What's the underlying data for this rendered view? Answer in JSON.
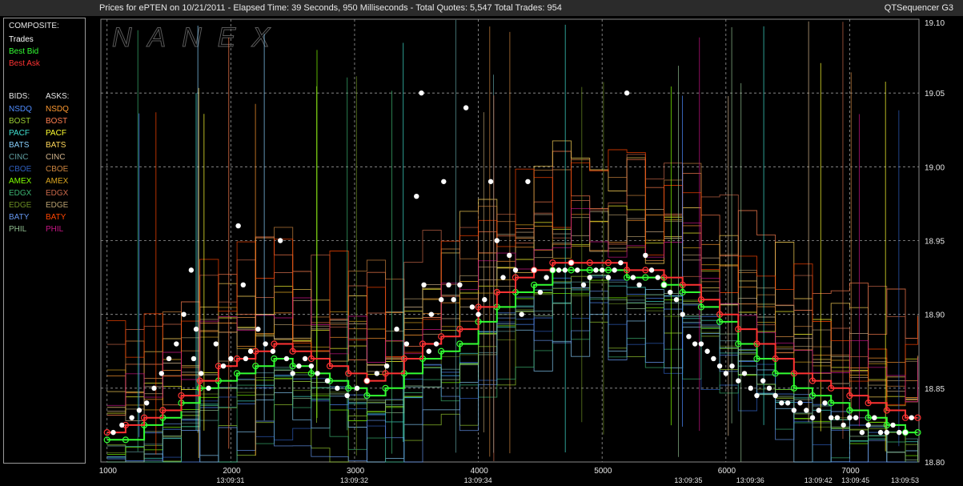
{
  "header": {
    "title": "Prices for  ePTEN  on  10/21/2011  - Elapsed Time: 39 Seconds, 950 Milliseconds  -  Total Quotes: 5,547  Total Trades: 954",
    "product": "QTSequencer G3"
  },
  "watermark": "NANEX",
  "legend": {
    "composite_heading": "COMPOSITE:",
    "composite": [
      {
        "label": "Trades",
        "color": "#ffffff"
      },
      {
        "label": "Best Bid",
        "color": "#33ff33"
      },
      {
        "label": "Best Ask",
        "color": "#ff3333"
      }
    ],
    "bids_heading": "BIDS:",
    "asks_heading": "ASKS:",
    "exchanges": [
      {
        "bid": "NSDQ",
        "ask": "NSDQ",
        "bid_color": "#4f8cff",
        "ask_color": "#ff9a30"
      },
      {
        "bid": "BOST",
        "ask": "BOST",
        "bid_color": "#9acd32",
        "ask_color": "#ff7f50"
      },
      {
        "bid": "PACF",
        "ask": "PACF",
        "bid_color": "#40e0d0",
        "ask_color": "#ffff30"
      },
      {
        "bid": "BATS",
        "ask": "BATS",
        "bid_color": "#87cefa",
        "ask_color": "#ffd75a"
      },
      {
        "bid": "CINC",
        "ask": "CINC",
        "bid_color": "#5f9ea0",
        "ask_color": "#d2b48c"
      },
      {
        "bid": "CBOE",
        "ask": "CBOE",
        "bid_color": "#2f5fbf",
        "ask_color": "#cd853f"
      },
      {
        "bid": "AMEX",
        "ask": "AMEX",
        "bid_color": "#7fff00",
        "ask_color": "#daa520"
      },
      {
        "bid": "EDGX",
        "ask": "EDGX",
        "bid_color": "#3cb371",
        "ask_color": "#c8684a"
      },
      {
        "bid": "EDGE",
        "ask": "EDGE",
        "bid_color": "#6b8e23",
        "ask_color": "#b8a070"
      },
      {
        "bid": "BATY",
        "ask": "BATY",
        "bid_color": "#6495ed",
        "ask_color": "#ff4500"
      },
      {
        "bid": "PHIL",
        "ask": "PHIL",
        "bid_color": "#8fbc8f",
        "ask_color": "#c71585"
      }
    ]
  },
  "chart_data": {
    "type": "line",
    "x_ticks": [
      1000,
      2000,
      3000,
      4000,
      5000,
      6000,
      7000
    ],
    "time_labels": [
      {
        "x": 2000,
        "label": "13:09:31"
      },
      {
        "x": 3000,
        "label": "13:09:32"
      },
      {
        "x": 4000,
        "label": "13:09:34"
      },
      {
        "x": 5700,
        "label": "13:09:35"
      },
      {
        "x": 6200,
        "label": "13:09:36"
      },
      {
        "x": 6750,
        "label": "13:09:42"
      },
      {
        "x": 7050,
        "label": "13:09:45"
      },
      {
        "x": 7450,
        "label": "13:09:53"
      }
    ],
    "y_ticks": [
      18.8,
      18.85,
      18.9,
      18.95,
      19.0,
      19.05,
      19.1
    ],
    "y_tick_labels": [
      "18.80",
      "18.85",
      "18.90",
      "18.95",
      "19.00",
      "19.05",
      "19.10"
    ],
    "xlim": [
      950,
      7560
    ],
    "ylim": [
      18.8,
      19.1
    ],
    "grid": true,
    "series": [
      {
        "name": "Best Bid",
        "color": "#33ff33",
        "x": [
          1000,
          1150,
          1300,
          1450,
          1600,
          1750,
          1900,
          2050,
          2200,
          2350,
          2500,
          2650,
          2800,
          2950,
          3100,
          3250,
          3400,
          3550,
          3700,
          3850,
          4000,
          4150,
          4300,
          4450,
          4600,
          4750,
          4900,
          5050,
          5200,
          5350,
          5500,
          5650,
          5800,
          5950,
          6100,
          6250,
          6400,
          6550,
          6700,
          6850,
          7000,
          7150,
          7300,
          7450,
          7550
        ],
        "y": [
          18.815,
          18.815,
          18.825,
          18.83,
          18.84,
          18.85,
          18.855,
          18.86,
          18.865,
          18.87,
          18.865,
          18.86,
          18.855,
          18.85,
          18.845,
          18.85,
          18.86,
          18.87,
          18.875,
          18.88,
          18.895,
          18.905,
          18.915,
          18.92,
          18.93,
          18.93,
          18.93,
          18.93,
          18.925,
          18.925,
          18.92,
          18.915,
          18.905,
          18.895,
          18.88,
          18.87,
          18.86,
          18.85,
          18.845,
          18.84,
          18.835,
          18.83,
          18.825,
          18.82,
          18.82
        ]
      },
      {
        "name": "Best Ask",
        "color": "#ff3333",
        "x": [
          1000,
          1150,
          1300,
          1450,
          1600,
          1750,
          1900,
          2050,
          2200,
          2350,
          2500,
          2650,
          2800,
          2950,
          3100,
          3250,
          3400,
          3550,
          3700,
          3850,
          4000,
          4150,
          4300,
          4450,
          4600,
          4750,
          4900,
          5050,
          5200,
          5350,
          5500,
          5650,
          5800,
          5950,
          6100,
          6250,
          6400,
          6550,
          6700,
          6850,
          7000,
          7150,
          7300,
          7450,
          7550
        ],
        "y": [
          18.82,
          18.825,
          18.83,
          18.835,
          18.845,
          18.855,
          18.865,
          18.87,
          18.875,
          18.88,
          18.875,
          18.87,
          18.865,
          18.86,
          18.855,
          18.86,
          18.87,
          18.88,
          18.885,
          18.89,
          18.905,
          18.915,
          18.925,
          18.93,
          18.935,
          18.935,
          18.935,
          18.935,
          18.93,
          18.93,
          18.925,
          18.92,
          18.91,
          18.9,
          18.89,
          18.88,
          18.87,
          18.86,
          18.855,
          18.85,
          18.845,
          18.84,
          18.835,
          18.83,
          18.83
        ]
      },
      {
        "name": "Trades",
        "color": "#ffffff",
        "style": "dots",
        "x": [
          1050,
          1120,
          1200,
          1260,
          1320,
          1380,
          1440,
          1500,
          1560,
          1620,
          1680,
          1700,
          1720,
          1760,
          1820,
          1880,
          1940,
          2000,
          2060,
          2100,
          2120,
          2160,
          2220,
          2280,
          2340,
          2400,
          2450,
          2500,
          2550,
          2600,
          2650,
          2700,
          2780,
          2860,
          2940,
          3020,
          3100,
          3180,
          3260,
          3340,
          3420,
          3500,
          3540,
          3560,
          3600,
          3620,
          3660,
          3700,
          3720,
          3760,
          3800,
          3850,
          3900,
          3950,
          4000,
          4050,
          4100,
          4150,
          4200,
          4250,
          4300,
          4350,
          4400,
          4450,
          4500,
          4550,
          4600,
          4650,
          4700,
          4750,
          4800,
          4850,
          4900,
          4950,
          5000,
          5050,
          5100,
          5150,
          5200,
          5250,
          5300,
          5350,
          5400,
          5450,
          5500,
          5550,
          5600,
          5650,
          5700,
          5750,
          5800,
          5850,
          5900,
          5950,
          6000,
          6050,
          6100,
          6150,
          6200,
          6250,
          6300,
          6350,
          6400,
          6450,
          6500,
          6550,
          6600,
          6650,
          6700,
          6750,
          6800,
          6850,
          6900,
          6950,
          7000,
          7050,
          7100,
          7150,
          7200,
          7250,
          7300,
          7350,
          7400,
          7450,
          7500
        ],
        "y": [
          18.82,
          18.825,
          18.83,
          18.835,
          18.84,
          18.85,
          18.86,
          18.87,
          18.88,
          18.9,
          18.93,
          18.87,
          18.89,
          18.86,
          18.85,
          18.88,
          18.865,
          18.87,
          18.96,
          18.92,
          18.87,
          18.875,
          18.89,
          18.88,
          18.875,
          18.95,
          18.87,
          18.86,
          18.865,
          18.87,
          18.865,
          18.86,
          18.855,
          18.85,
          18.845,
          18.85,
          18.855,
          18.86,
          18.865,
          18.89,
          18.88,
          18.98,
          19.05,
          18.92,
          18.875,
          18.9,
          18.88,
          18.91,
          18.99,
          18.92,
          18.91,
          18.92,
          19.04,
          18.905,
          18.9,
          18.91,
          18.99,
          18.95,
          18.925,
          18.94,
          18.93,
          18.9,
          18.99,
          18.93,
          18.915,
          18.925,
          18.93,
          18.93,
          18.93,
          18.935,
          18.93,
          18.92,
          18.925,
          18.93,
          18.93,
          18.925,
          18.93,
          18.935,
          19.05,
          18.925,
          18.92,
          18.94,
          18.93,
          18.925,
          18.92,
          18.915,
          18.91,
          18.9,
          18.885,
          18.88,
          18.88,
          18.875,
          18.87,
          18.865,
          18.86,
          18.865,
          18.855,
          18.86,
          18.85,
          18.845,
          18.855,
          18.85,
          18.845,
          18.84,
          18.84,
          18.835,
          18.84,
          18.835,
          18.83,
          18.835,
          18.84,
          18.83,
          18.83,
          18.825,
          18.83,
          18.83,
          18.82,
          18.825,
          18.83,
          18.82,
          18.82,
          18.825,
          18.82,
          18.82,
          18.83
        ]
      }
    ]
  }
}
